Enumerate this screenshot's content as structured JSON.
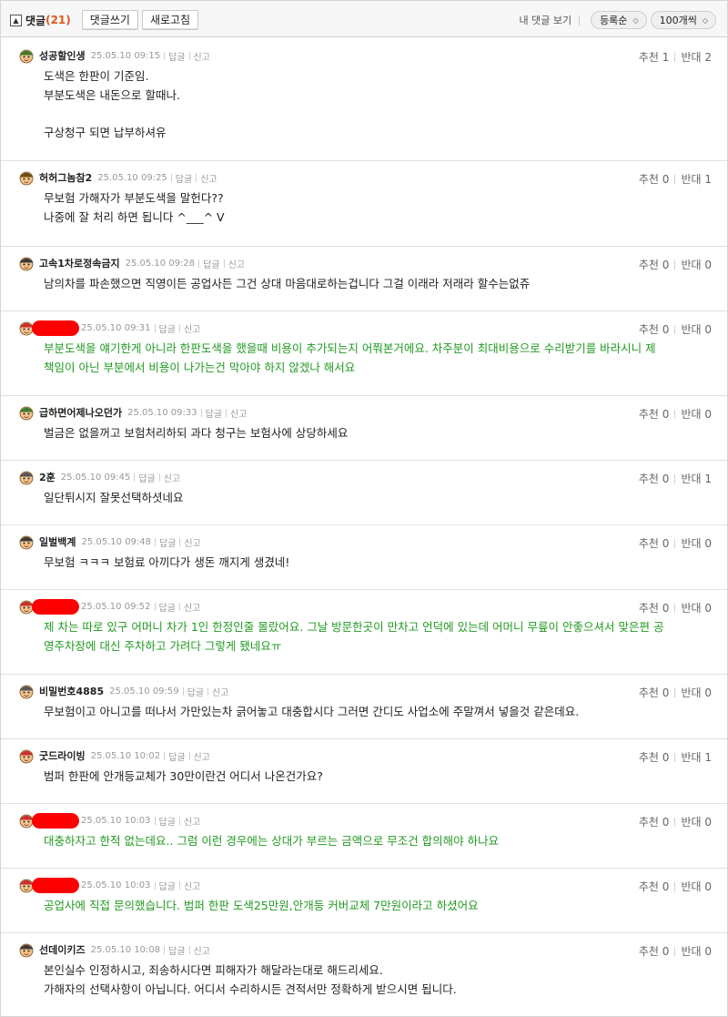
{
  "header": {
    "collapse_icon": "▲",
    "title": "댓글",
    "count": "(21)",
    "write_button": "댓글쓰기",
    "refresh_button": "새로고침",
    "my_comments": "내 댓글 보기",
    "sort_select": "등록순",
    "page_size_select": "100개씩"
  },
  "comment_links": {
    "reply": "답글",
    "report": "신고"
  },
  "vote_labels": {
    "up": "추천",
    "down": "반대"
  },
  "comments": [
    {
      "nick": "성공할인생",
      "time": "25.05.10 09:15",
      "up": "1",
      "down": "2",
      "lines": [
        "도색은 한판이 기준임.",
        "부분도색은 내돈으로 할때나.",
        "",
        "구상청구 되면 납부하셔유"
      ]
    },
    {
      "nick": "허허그놈참2",
      "time": "25.05.10 09:25",
      "up": "0",
      "down": "1",
      "lines": [
        "무보험 가해자가 부분도색을 말헌다??",
        "나중에 잘 처리 하면 됩니다 ^___^ V"
      ]
    },
    {
      "nick": "고속1차로정속금지",
      "time": "25.05.10 09:28",
      "up": "0",
      "down": "0",
      "lines": [
        "남의차를 파손했으면 직영이든 공업사든 그건 상대 마음대로하는겁니다 그걸 이래라 저래라 할수는없쥬"
      ]
    },
    {
      "nick": "",
      "time": "25.05.10 09:31",
      "up": "0",
      "down": "0",
      "lines": [
        "부분도색을 얘기한게 아니라 한판도색을 했을때 비용이 추가되는지 어쭤본거에요. 차주분이 최대비용으로 수리받기를 바라시니 제",
        "책임이 아닌 부분에서 비용이 나가는건 막아야 하지 않겠나 해서요"
      ]
    },
    {
      "nick": "급하면어제나오던가",
      "time": "25.05.10 09:33",
      "up": "0",
      "down": "0",
      "lines": [
        "벌금은 없을꺼고 보험처리하되 과다 청구는 보험사에 상당하세요"
      ]
    },
    {
      "nick": "2훈",
      "time": "25.05.10 09:45",
      "up": "0",
      "down": "1",
      "lines": [
        "일단튀시지 잘못선택하셧네요"
      ]
    },
    {
      "nick": "일벌백계",
      "time": "25.05.10 09:48",
      "up": "0",
      "down": "0",
      "lines": [
        "무보험 ㅋㅋㅋ 보험료 아끼다가 생돈 깨지게 생겼네!"
      ]
    },
    {
      "nick": "",
      "time": "25.05.10 09:52",
      "up": "0",
      "down": "0",
      "lines": [
        "제 차는 따로 있구 어머니 차가 1인 한정인줄 몰랐어요. 그날 방문한곳이 만차고 언덕에 있는데 어머니 무릎이 안좋으셔서 맞은편 공",
        "영주차장에 대신 주차하고 가려다 그렇게 됐네요ㅠ"
      ]
    },
    {
      "nick": "비밀번호4885",
      "time": "25.05.10 09:59",
      "up": "0",
      "down": "0",
      "lines": [
        "무보험이고 아니고를 떠나서 가만있는차 긁어놓고 대충합시다 그러면 간디도 사업소에 주말껴서 넣을것 같은데요."
      ]
    },
    {
      "nick": "굿드라이빙",
      "time": "25.05.10 10:02",
      "up": "0",
      "down": "1",
      "lines": [
        "범퍼 한판에 안개등교체가 30만이란건 어디서 나온건가요?"
      ]
    },
    {
      "nick": "",
      "time": "25.05.10 10:03",
      "up": "0",
      "down": "0",
      "lines": [
        "대충하자고 한적 없는데요.. 그럼 이런 경우에는 상대가 부르는 금액으로 무조건 합의해야 하나요"
      ]
    },
    {
      "nick": "",
      "time": "25.05.10 10:03",
      "up": "0",
      "down": "0",
      "lines": [
        "공업사에 직접 문의했습니다. 범퍼 한판 도색25만원,안개등 커버교체 7만원이라고 하셨어요"
      ]
    },
    {
      "nick": "선데이키즈",
      "time": "25.05.10 10:08",
      "up": "0",
      "down": "0",
      "lines": [
        "본인실수 인정하시고, 죄송하시다면 피해자가 해달라는대로 해드리세요.",
        "가해자의 선택사항이 아닙니다. 어디서 수리하시든 견적서만 정확하게 받으시면 됩니다."
      ]
    }
  ]
}
